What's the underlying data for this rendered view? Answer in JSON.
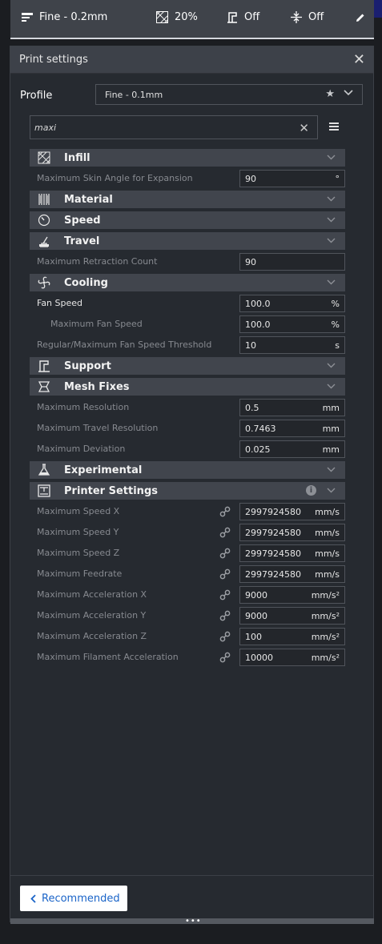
{
  "topbar": {
    "profile_label": "Fine - 0.2mm",
    "infill_label": "20%",
    "support_label": "Off",
    "adhesion_label": "Off"
  },
  "panel": {
    "title": "Print settings",
    "profile_label": "Profile",
    "profile_value": "Fine - 0.1mm",
    "search_value": "maxi"
  },
  "settings": [
    {
      "kind": "cat",
      "icon": "infill-icon",
      "label": "Infill"
    },
    {
      "kind": "row",
      "label": "Maximum Skin Angle for Expansion",
      "value": "90",
      "unit": "°"
    },
    {
      "kind": "cat",
      "icon": "material-icon",
      "label": "Material"
    },
    {
      "kind": "cat",
      "icon": "speed-icon",
      "label": "Speed"
    },
    {
      "kind": "cat",
      "icon": "travel-icon",
      "label": "Travel"
    },
    {
      "kind": "row",
      "label": "Maximum Retraction Count",
      "value": "90",
      "unit": ""
    },
    {
      "kind": "cat",
      "icon": "cooling-icon",
      "label": "Cooling"
    },
    {
      "kind": "row",
      "label": "Fan Speed",
      "value": "100.0",
      "unit": "%",
      "bright": true
    },
    {
      "kind": "row",
      "label": "Maximum Fan Speed",
      "value": "100.0",
      "unit": "%",
      "indent": true
    },
    {
      "kind": "row",
      "label": "Regular/Maximum Fan Speed Threshold",
      "value": "10",
      "unit": "s"
    },
    {
      "kind": "cat",
      "icon": "support-icon",
      "label": "Support"
    },
    {
      "kind": "cat",
      "icon": "mesh-fixes-icon",
      "label": "Mesh Fixes"
    },
    {
      "kind": "row",
      "label": "Maximum Resolution",
      "value": "0.5",
      "unit": "mm"
    },
    {
      "kind": "row",
      "label": "Maximum Travel Resolution",
      "value": "0.7463",
      "unit": "mm"
    },
    {
      "kind": "row",
      "label": "Maximum Deviation",
      "value": "0.025",
      "unit": "mm"
    },
    {
      "kind": "cat",
      "icon": "experimental-icon",
      "label": "Experimental"
    },
    {
      "kind": "cat",
      "icon": "printer-icon",
      "label": "Printer Settings",
      "info": true
    },
    {
      "kind": "row",
      "label": "Maximum Speed X",
      "value": "2997924580",
      "unit": "mm/s",
      "link": true
    },
    {
      "kind": "row",
      "label": "Maximum Speed Y",
      "value": "2997924580",
      "unit": "mm/s",
      "link": true
    },
    {
      "kind": "row",
      "label": "Maximum Speed Z",
      "value": "2997924580",
      "unit": "mm/s",
      "link": true
    },
    {
      "kind": "row",
      "label": "Maximum Feedrate",
      "value": "2997924580",
      "unit": "mm/s",
      "link": true
    },
    {
      "kind": "row",
      "label": "Maximum Acceleration X",
      "value": "9000",
      "unit": "mm/s²",
      "link": true
    },
    {
      "kind": "row",
      "label": "Maximum Acceleration Y",
      "value": "9000",
      "unit": "mm/s²",
      "link": true
    },
    {
      "kind": "row",
      "label": "Maximum Acceleration Z",
      "value": "100",
      "unit": "mm/s²",
      "link": true
    },
    {
      "kind": "row",
      "label": "Maximum Filament Acceleration",
      "value": "10000",
      "unit": "mm/s²",
      "link": true
    }
  ],
  "footer": {
    "recommended_label": "Recommended"
  },
  "colors": {
    "accent": "#1a64c8",
    "panel_bg": "#262a30",
    "category_bg": "#41454d"
  }
}
